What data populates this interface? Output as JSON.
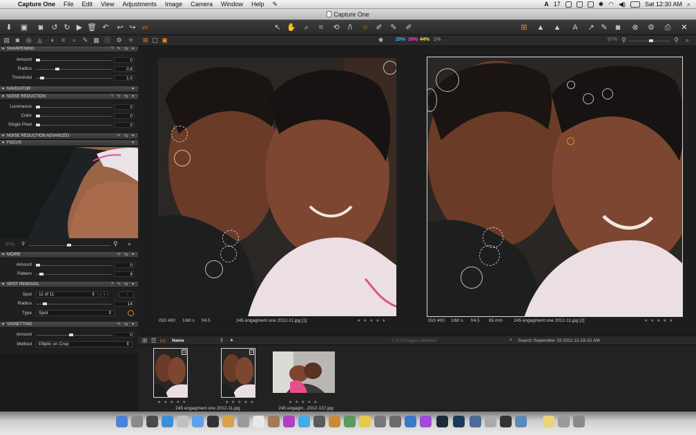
{
  "menubar": {
    "app": "Capture One",
    "items": [
      "File",
      "Edit",
      "View",
      "Adjustments",
      "Image",
      "Camera",
      "Window",
      "Help"
    ],
    "clock": "Sat 12:30 AM",
    "status_badge": "17"
  },
  "window": {
    "title": "Capture One"
  },
  "subbar": {
    "pct1": "20%",
    "pct2": "39%",
    "pct3": "44%",
    "pct4": "1%",
    "zoom": "67%",
    "colors": {
      "pct1": "#33c2ff",
      "pct2": "#ff3fc5",
      "pct3": "#f5e642",
      "pct4": "#aaaaaa"
    }
  },
  "sharpening": {
    "title": "SHARPENING",
    "amount_label": "Amount",
    "amount": "0",
    "radius_label": "Radius",
    "radius": "0.8",
    "threshold_label": "Threshold",
    "threshold": "1.0"
  },
  "navigator": {
    "title": "NAVIGATOR"
  },
  "noise": {
    "title": "NOISE REDUCTION",
    "luminance_label": "Luminance",
    "luminance": "0",
    "color_label": "Color",
    "color": "0",
    "single_label": "Single Pixel",
    "single": "0"
  },
  "noise_adv": {
    "title": "NOISE REDUCTION ADVANCED"
  },
  "focus": {
    "title": "FOCUS",
    "zoom": "97%"
  },
  "moire": {
    "title": "MOIRE",
    "amount_label": "Amount",
    "amount": "0",
    "pattern_label": "Pattern",
    "pattern": "8"
  },
  "spot_removal": {
    "title": "SPOT REMOVAL",
    "spot_label": "Spot",
    "spot_value": "11 of 11",
    "radius_label": "Radius",
    "radius": "14",
    "type_label": "Type",
    "type_value": "Spot"
  },
  "vignetting": {
    "title": "VIGNETTING",
    "amount_label": "Amount",
    "amount": "0",
    "method_label": "Method",
    "method_value": "Elliptic on Crop"
  },
  "viewer": {
    "left": {
      "iso": "ISO 400",
      "shutter": "1/60 s",
      "aperture": "f/4.5",
      "name": "245 engagment one 2012-11.jpg [1]"
    },
    "right": {
      "iso": "ISO 400",
      "shutter": "1/60 s",
      "aperture": "f/4.5",
      "focal": "85 mm",
      "name": "245 engagment one 2012-11.jpg [2]"
    },
    "stars": "★ ★ ★ ★ ★"
  },
  "browser": {
    "sort_label": "Name",
    "selection": "2 of 3 images selected",
    "search": "Search September 29 2012 12-18-32 AM",
    "thumbs": [
      {
        "caption": "245 engagment one 2012-11.jpg",
        "badge": "1"
      },
      {
        "caption": "",
        "badge": "2"
      },
      {
        "caption": "245 engagm...2012-137.jpg",
        "badge": ""
      }
    ],
    "stars": "★ ★ ★ ★ ★"
  }
}
